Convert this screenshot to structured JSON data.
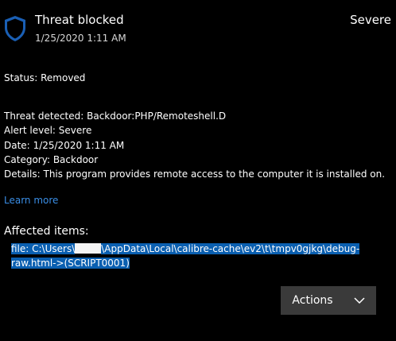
{
  "header": {
    "title": "Threat blocked",
    "timestamp": "1/25/2020 1:11 AM",
    "severity": "Severe",
    "icon": "shield-icon"
  },
  "status": {
    "label": "Status:",
    "value": "Removed"
  },
  "details": [
    {
      "label": "Threat detected:",
      "value": "Backdoor:PHP/Remoteshell.D"
    },
    {
      "label": "Alert level:",
      "value": "Severe"
    },
    {
      "label": "Date:",
      "value": "1/25/2020 1:11 AM"
    },
    {
      "label": "Category:",
      "value": "Backdoor"
    },
    {
      "label": "Details:",
      "value": "This program provides remote access to the computer it is installed on."
    }
  ],
  "learn_more": "Learn more",
  "affected": {
    "title": "Affected items:",
    "path_prefix": "file: C:\\Users\\",
    "path_suffix": "\\AppData\\Local\\calibre-cache\\ev2\\t\\tmpv0gjkg\\debug-",
    "path_line2": "raw.html->(SCRIPT0001)"
  },
  "actions": {
    "label": "Actions",
    "icon": "chevron-down-icon"
  },
  "colors": {
    "background": "#000000",
    "link": "#3a8ee6",
    "selection": "#0a5fb0",
    "button": "#3a3a3a"
  }
}
